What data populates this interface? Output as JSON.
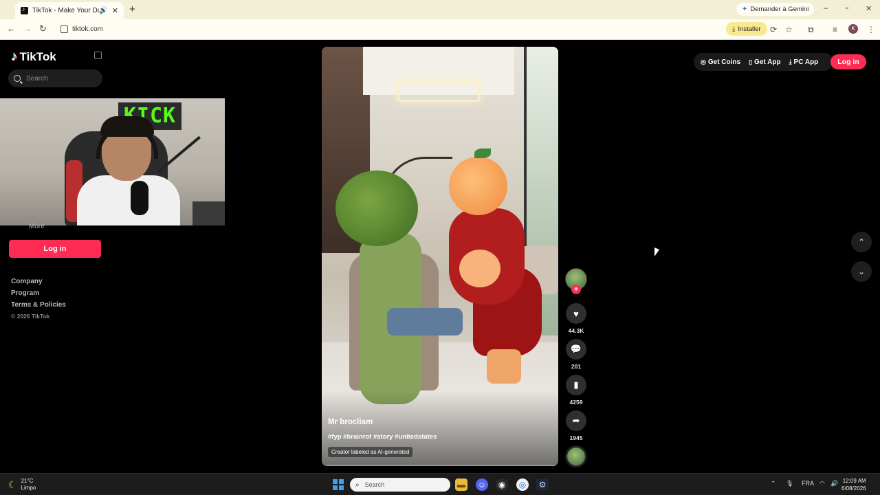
{
  "browser": {
    "tab_title": "TikTok - Make Your Day",
    "gemini_label": "Demander à Gemini",
    "url": "tiktok.com",
    "install_label": "Installer",
    "profile_initial": "K"
  },
  "sidebar": {
    "brand": "TikTok",
    "search_placeholder": "Search",
    "more_label": "More",
    "login_label": "Log in",
    "footer_links": [
      "Company",
      "Program",
      "Terms & Policies"
    ],
    "copyright": "© 2026 TikTok"
  },
  "webcam": {
    "sign_text": "KICK"
  },
  "video": {
    "author": "Mr brocliam",
    "caption": "#fyp #brainrot #story #unitedstates",
    "ai_label": "Creator labeled as AI-generated",
    "progress": 0.02
  },
  "actions": {
    "likes": "44.3K",
    "comments": "201",
    "saves": "4259",
    "shares": "1945"
  },
  "header": {
    "get_coins": "Get Coins",
    "get_app": "Get App",
    "pc_app": "PC App",
    "login": "Log in"
  },
  "taskbar": {
    "temperature": "21°C",
    "condition": "Limpo",
    "search_placeholder": "Search",
    "language": "FRA",
    "time": "12:09 AM",
    "date": "6/08/2026"
  },
  "colors": {
    "accent": "#fe2c55",
    "background": "#000000"
  }
}
